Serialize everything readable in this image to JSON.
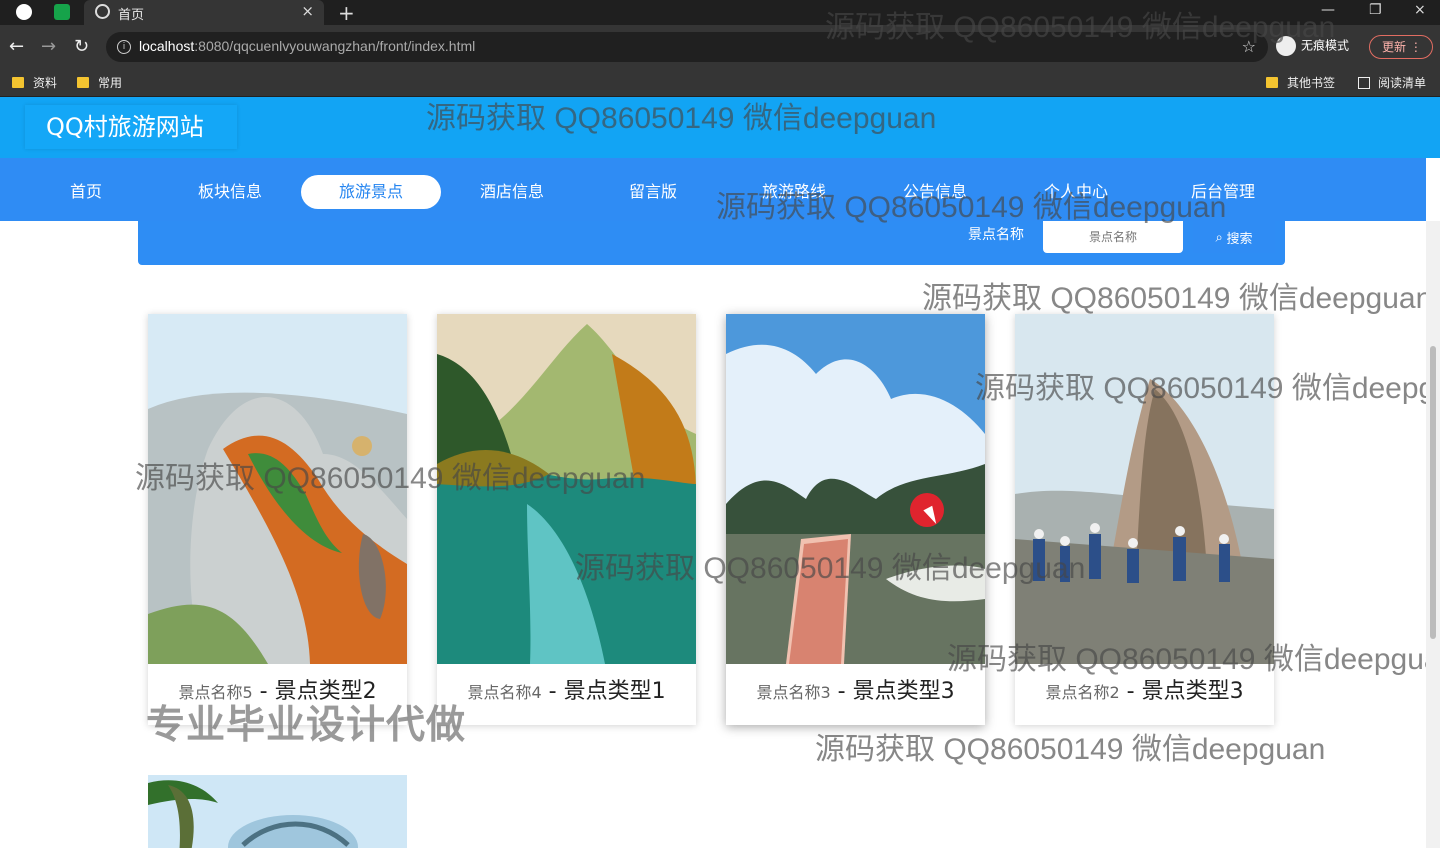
{
  "browser": {
    "tab_title": "首页",
    "url_host": "localhost",
    "url_path": ":8080/qqcuenlvyouwangzhan/front/index.html",
    "incognito_label": "无痕模式",
    "update_label": "更新",
    "bookmarks": [
      "资料",
      "常用",
      "其他书签",
      "阅读清单"
    ]
  },
  "site": {
    "title": "QQ村旅游网站",
    "nav": [
      "首页",
      "板块信息",
      "旅游景点",
      "酒店信息",
      "留言版",
      "旅游路线",
      "公告信息",
      "个人中心",
      "后台管理"
    ],
    "active_nav": "旅游景点"
  },
  "search": {
    "label": "景点名称",
    "placeholder": "景点名称",
    "button_label": "搜索"
  },
  "cards": [
    {
      "name": "景点名称5",
      "type": "景点类型2"
    },
    {
      "name": "景点名称4",
      "type": "景点类型1"
    },
    {
      "name": "景点名称3",
      "type": "景点类型3"
    },
    {
      "name": "景点名称2",
      "type": "景点类型3"
    }
  ],
  "watermark": "源码获取 QQ86050149 微信deepguan",
  "big_watermark": "专业毕业设计代做",
  "colors": {
    "header_blue": "#12a4f4",
    "nav_blue": "#2f8cf4",
    "browser_dark": "#353535"
  },
  "icons": [
    "globe-icon",
    "back-icon",
    "forward-icon",
    "refresh-icon",
    "info-icon",
    "star-icon",
    "search-icon",
    "folder-icon"
  ]
}
